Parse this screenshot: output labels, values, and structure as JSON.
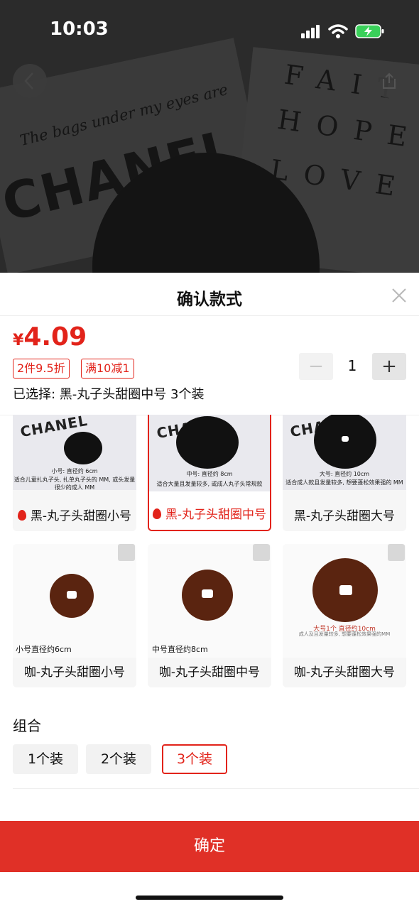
{
  "status_bar": {
    "time": "10:03"
  },
  "background": {
    "poster_left_line": "The bags under my eyes are",
    "poster_left_brand": "CHANEL",
    "poster_right_lines": [
      "FAIT",
      "HOPE",
      "LOVE"
    ]
  },
  "sheet": {
    "title": "确认款式",
    "price_symbol": "¥",
    "price_value": "4.09",
    "tags": [
      "2件9.5折",
      "满10减1"
    ],
    "quantity": "1",
    "selected_text": "已选择: 黑-丸子头甜圈中号 3个装"
  },
  "variants": [
    {
      "label": "黑-丸子头甜圈小号",
      "hot": true,
      "selected": false,
      "caption1": "小号: 直径约 6cm",
      "caption2": "适合儿童扎丸子头, 扎单丸子头的 MM, 或头发量很少的成人 MM"
    },
    {
      "label": "黑-丸子头甜圈中号",
      "hot": true,
      "selected": true,
      "caption1": "中号: 直径约 8cm",
      "caption2": "适合大量且发量较多, 或成人丸子头常规款"
    },
    {
      "label": "黑-丸子头甜圈大号",
      "hot": false,
      "selected": false,
      "caption1": "大号: 直径约 10cm",
      "caption2": "适合成人款且发量较多, 想要蓬松效果强的 MM"
    },
    {
      "label": "咖-丸子头甜圈小号",
      "hot": false,
      "selected": false,
      "caption1": "小号直径约6cm",
      "caption2": ""
    },
    {
      "label": "咖-丸子头甜圈中号",
      "hot": false,
      "selected": false,
      "caption1": "中号直径约8cm",
      "caption2": ""
    },
    {
      "label": "咖-丸子头甜圈大号",
      "hot": false,
      "selected": false,
      "caption1": "大号1个  直径约10cm",
      "caption2": "成人及且发量较多, 想要蓬松效果强的MM"
    }
  ],
  "group": {
    "title": "组合",
    "options": [
      "1个装",
      "2个装",
      "3个装"
    ],
    "selected": "3个装"
  },
  "confirm_label": "确定",
  "colors": {
    "accent": "#e2231a",
    "confirm_bg": "#e03027"
  }
}
